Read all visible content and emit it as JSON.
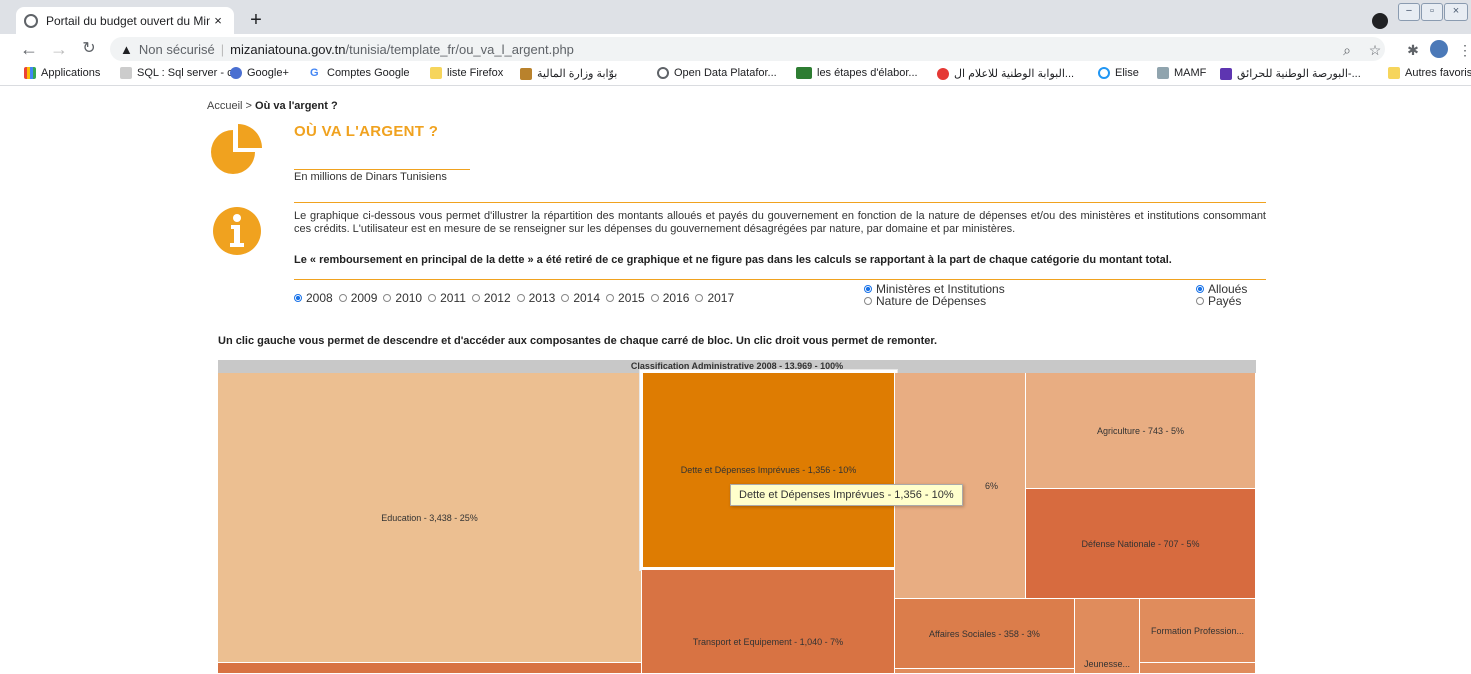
{
  "browser": {
    "tab_title": "Portail du budget ouvert du Mini",
    "tab_close": "×",
    "new_tab": "+",
    "security_label": "Non sécurisé",
    "url_domain": "mizaniatouna.gov.tn",
    "url_path": "/tunisia/template_fr/ou_va_l_argent.php",
    "bookmarks": [
      "Applications",
      "SQL : Sql server - c...",
      "Google+",
      "Comptes Google",
      "liste Firefox",
      "بوّابة وزارة المالية",
      "Open Data Platafor...",
      "les étapes d'élabor...",
      "البوابة الوطنية للاعلام ال...",
      "Elise",
      "MAMF",
      "البورصة الوطنية للحرائق-...",
      "Autres favoris"
    ]
  },
  "page": {
    "breadcrumb_home": "Accueil",
    "breadcrumb_sep": " > ",
    "breadcrumb_current": "Où va l'argent ?",
    "title": "OÙ VA L'ARGENT ?",
    "units": "En millions de Dinars Tunisiens",
    "description": "Le graphique ci-dessous vous permet d'illustrer la répartition des montants alloués et payés du gouvernement en fonction de la nature de dépenses et/ou des ministères et institutions consommant ces crédits. L'utilisateur est en mesure de se renseigner sur les dépenses du gouvernement désagrégées par nature, par domaine et par ministères.",
    "note": "Le « remboursement en principal de la dette » a été retiré de ce graphique et ne figure pas dans les calculs se rapportant à la part de chaque catégorie du montant total.",
    "years": [
      "2008",
      "2009",
      "2010",
      "2011",
      "2012",
      "2013",
      "2014",
      "2015",
      "2016",
      "2017"
    ],
    "selected_year": "2008",
    "classification_options": [
      "Ministères et Institutions",
      "Nature de Dépenses"
    ],
    "amount_options": [
      "Alloués",
      "Payés"
    ],
    "instruction": "Un clic gauche vous permet de descendre et d'accéder aux composantes de chaque carré de bloc. Un clic droit vous permet de remonter.",
    "tooltip": "Dette et Dépenses Imprévues - 1,356 - 10%"
  },
  "chart_data": {
    "type": "treemap",
    "title": "Classification Administrative 2008 - 13,969 - 100%",
    "total": 13969,
    "items": [
      {
        "label": "Education - 3,438 - 25%",
        "name": "Education",
        "value": 3438,
        "percent": 25,
        "color": "#ecbf91"
      },
      {
        "label": "Dette et Dépenses Imprévues - 1,356 - 10%",
        "name": "Dette et Dépenses Imprévues",
        "value": 1356,
        "percent": 10,
        "color": "#de7c02"
      },
      {
        "label": "Transport et Equipement - 1,040 - 7%",
        "name": "Transport et Equipement",
        "value": 1040,
        "percent": 7,
        "color": "#d87343"
      },
      {
        "label": "6%",
        "name": "",
        "value": null,
        "percent": 6,
        "color": "#e8ad82"
      },
      {
        "label": "Agriculture - 743 - 5%",
        "name": "Agriculture",
        "value": 743,
        "percent": 5,
        "color": "#e8ad82"
      },
      {
        "label": "Défense Nationale - 707 - 5%",
        "name": "Défense Nationale",
        "value": 707,
        "percent": 5,
        "color": "#d76b3f"
      },
      {
        "label": "Affaires Sociales - 358 - 3%",
        "name": "Affaires Sociales",
        "value": 358,
        "percent": 3,
        "color": "#db7d4b"
      },
      {
        "label": "Jeunesse...",
        "name": "Jeunesse...",
        "value": null,
        "percent": null,
        "color": "#e08c5c"
      },
      {
        "label": "Formation Profession...",
        "name": "Formation Profession...",
        "value": null,
        "percent": null,
        "color": "#e08c5c"
      }
    ],
    "highlighted": "Dette et Dépenses Imprévues"
  }
}
